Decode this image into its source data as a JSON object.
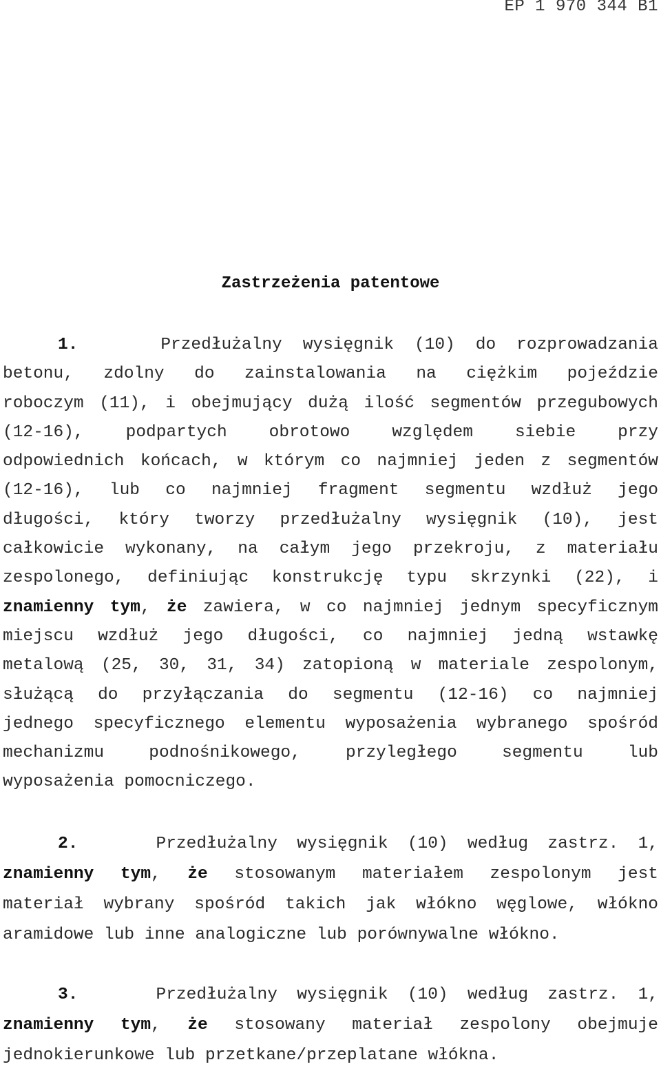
{
  "header": {
    "doc_number": "EP 1 970 344 B1"
  },
  "title": "Zastrzeżenia patentowe",
  "claims": [
    {
      "number": "1.",
      "lines": [
        "Przedłużalny wysięgnik (10) do rozprowadzania",
        "betonu, zdolny do zainstalowania na ciężkim pojeździe",
        "roboczym (11), i obejmujący dużą ilość segmentów przegubowych",
        "(12-16), podpartych obrotowo względem siebie przy",
        "odpowiednich końcach, w którym co najmniej jeden z segmentów",
        "(12-16), lub co najmniej fragment segmentu wzdłuż jego",
        "długości, który tworzy przedłużalny wysięgnik (10), jest",
        "całkowicie wykonany, na całym jego przekroju, z materiału",
        "zespolonego, definiując konstrukcję typu skrzynki (22), i",
        "zawiera, w co najmniej jednym specyficznym",
        "miejscu wzdłuż jego długości, co najmniej jedną wstawkę",
        "metalową (25, 30, 31, 34) zatopioną w materiale zespolonym,",
        "służącą do przyłączania do segmentu (12-16) co najmniej",
        "jednego specyficznego elementu wyposażenia wybranego spośród",
        "mechanizmu podnośnikowego, przyległego segmentu lub",
        "wyposażenia pomocniczego."
      ],
      "bold_phrase": "znamienny tym",
      "bold_phrase_2": "że"
    },
    {
      "number": "2.",
      "lines": [
        "Przedłużalny wysięgnik (10) według zastrz. 1,",
        "stosowanym materiałem zespolonym jest",
        "materiał wybrany spośród takich jak włókno węglowe, włókno",
        "aramidowe lub inne analogiczne lub porównywalne włókno."
      ],
      "bold_phrase": "znamienny tym",
      "bold_phrase_2": "że"
    },
    {
      "number": "3.",
      "lines": [
        "Przedłużalny wysięgnik (10) według zastrz. 1,",
        "stosowany materiał zespolony obejmuje",
        "jednokierunkowe lub przetkane/przeplatane włókna."
      ],
      "bold_phrase": "znamienny tym",
      "bold_phrase_2": "że"
    }
  ],
  "punct": {
    "comma": ","
  }
}
